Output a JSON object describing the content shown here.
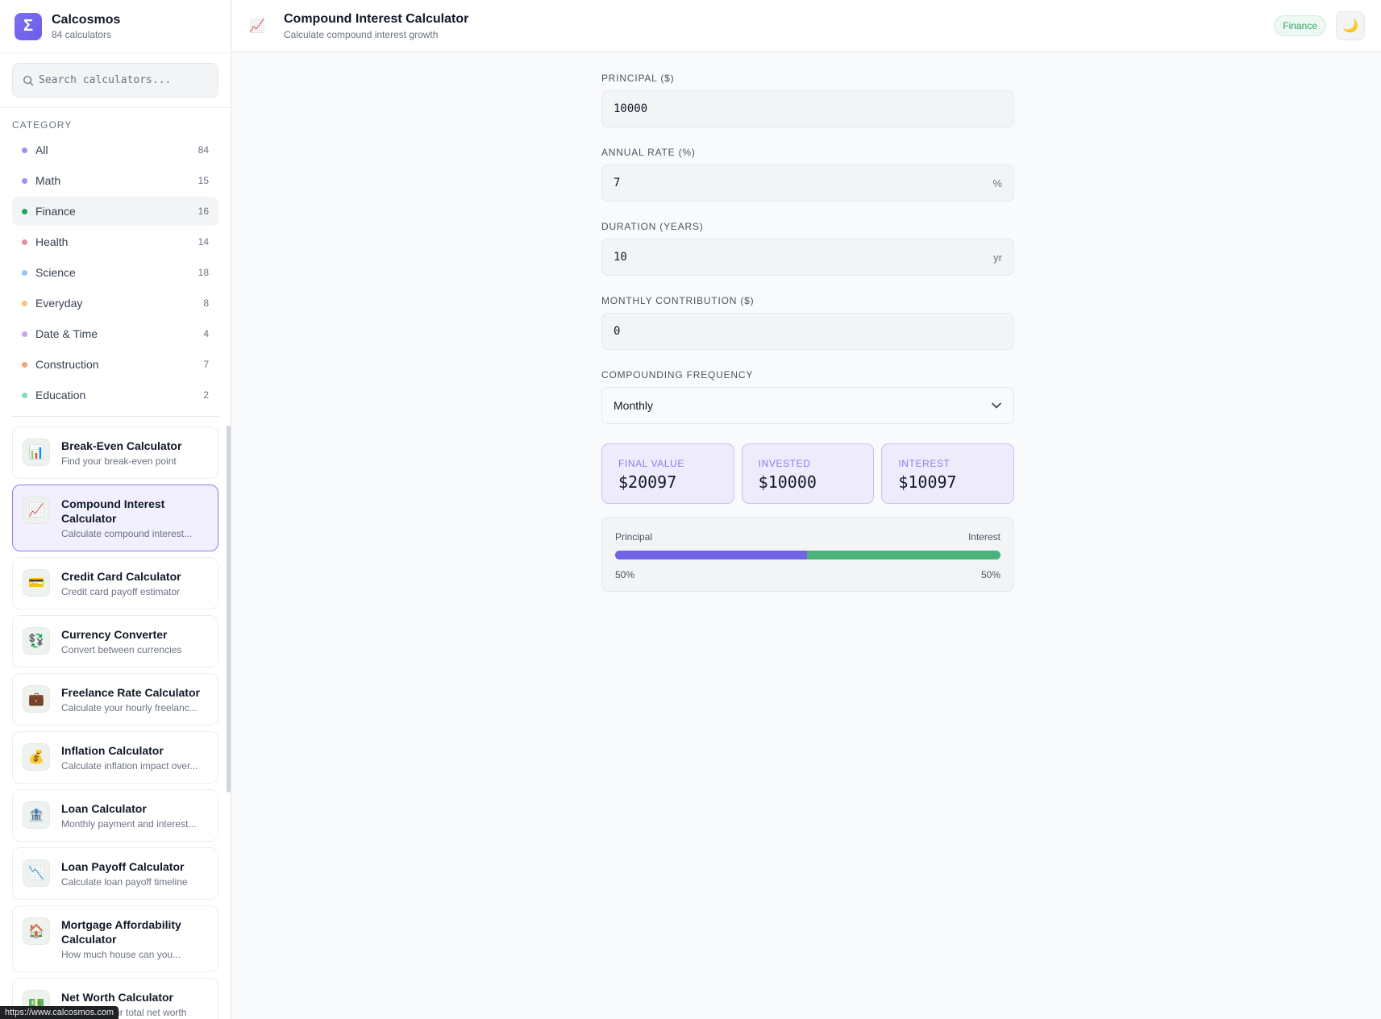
{
  "brand": {
    "name": "Calcosmos",
    "subtitle": "84 calculators"
  },
  "search": {
    "placeholder": "Search calculators..."
  },
  "categories": {
    "title": "CATEGORY",
    "items": [
      {
        "label": "All",
        "count": "84",
        "color": "#a78bfa"
      },
      {
        "label": "Math",
        "count": "15",
        "color": "#a78bfa"
      },
      {
        "label": "Finance",
        "count": "16",
        "color": "#22a55a"
      },
      {
        "label": "Health",
        "count": "14",
        "color": "#f08aa0"
      },
      {
        "label": "Science",
        "count": "18",
        "color": "#93c5fd"
      },
      {
        "label": "Everyday",
        "count": "8",
        "color": "#fbbf77"
      },
      {
        "label": "Date & Time",
        "count": "4",
        "color": "#c4a5f0"
      },
      {
        "label": "Construction",
        "count": "7",
        "color": "#f5a47a"
      },
      {
        "label": "Education",
        "count": "2",
        "color": "#86dcb4"
      }
    ]
  },
  "calculators": [
    {
      "name": "Break-Even Calculator",
      "desc": "Find your break-even point",
      "icon": "📊"
    },
    {
      "name": "Compound Interest Calculator",
      "desc": "Calculate compound interest...",
      "icon": "📈"
    },
    {
      "name": "Credit Card Calculator",
      "desc": "Credit card payoff estimator",
      "icon": "💳"
    },
    {
      "name": "Currency Converter",
      "desc": "Convert between currencies",
      "icon": "💱"
    },
    {
      "name": "Freelance Rate Calculator",
      "desc": "Calculate your hourly freelanc...",
      "icon": "💼"
    },
    {
      "name": "Inflation Calculator",
      "desc": "Calculate inflation impact over...",
      "icon": "💰"
    },
    {
      "name": "Loan Calculator",
      "desc": "Monthly payment and interest...",
      "icon": "🏦"
    },
    {
      "name": "Loan Payoff Calculator",
      "desc": "Calculate loan payoff timeline",
      "icon": "📉"
    },
    {
      "name": "Mortgage Affordability Calculator",
      "desc": "How much house can you...",
      "icon": "🏠"
    },
    {
      "name": "Net Worth Calculator",
      "desc": "Calculate your total net worth",
      "icon": "💵"
    }
  ],
  "status_url": "https://www.calcosmos.com",
  "header": {
    "icon": "chart-increasing-icon",
    "title": "Compound Interest Calculator",
    "subtitle": "Calculate compound interest growth",
    "badge": "Finance",
    "theme_icon": "🌙"
  },
  "form": {
    "principal": {
      "label": "PRINCIPAL ($)",
      "value": "10000"
    },
    "rate": {
      "label": "ANNUAL RATE (%)",
      "value": "7",
      "suffix": "%"
    },
    "duration": {
      "label": "DURATION (YEARS)",
      "value": "10",
      "suffix": "yr"
    },
    "contribution": {
      "label": "MONTHLY CONTRIBUTION ($)",
      "value": "0"
    },
    "frequency": {
      "label": "COMPOUNDING FREQUENCY",
      "value": "Monthly"
    }
  },
  "results": {
    "final": {
      "label": "FINAL VALUE",
      "value": "$20097"
    },
    "invested": {
      "label": "INVESTED",
      "value": "$10000"
    },
    "interest": {
      "label": "INTEREST",
      "value": "$10097"
    }
  },
  "breakdown": {
    "left_label": "Principal",
    "right_label": "Interest",
    "left_pct": "50%",
    "right_pct": "50%",
    "principal_fraction": 0.4976
  },
  "colors": {
    "accent": "#7164e4",
    "interest": "#4cb27c",
    "finance": "#2fa565"
  }
}
